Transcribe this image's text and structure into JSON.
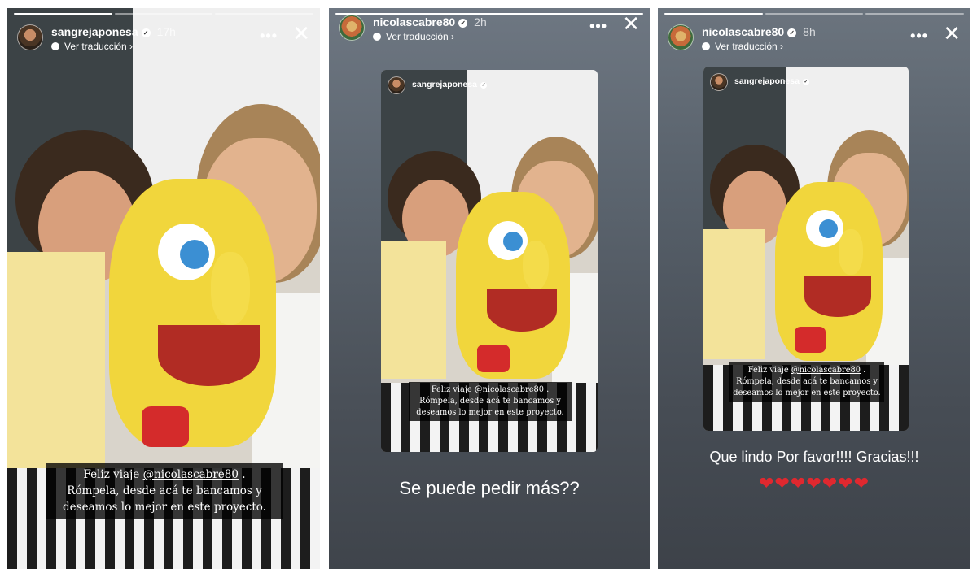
{
  "panels": [
    {
      "username": "sangrejaponesa",
      "time": "17h",
      "translate_label": "Ver traducción",
      "more": "•••",
      "close": "✕",
      "caption": {
        "prefix": "Feliz viaje ",
        "mention": "@nicolascabre80",
        "suffix": " .",
        "line2": "Rómpela, desde acá te bancamos y",
        "line3": "deseamos lo mejor en este proyecto."
      }
    },
    {
      "username": "nicolascabre80",
      "time": "2h",
      "translate_label": "Ver traducción",
      "more": "•••",
      "close": "✕",
      "embedded_username": "sangrejaponesa",
      "caption": {
        "prefix": "Feliz viaje ",
        "mention": "@nicolascabre80",
        "suffix": " .",
        "line2": "Rómpela, desde acá te bancamos y",
        "line3": "deseamos lo mejor en este proyecto."
      },
      "message": "Se puede pedir más??"
    },
    {
      "username": "nicolascabre80",
      "time": "8h",
      "translate_label": "Ver traducción",
      "more": "•••",
      "close": "✕",
      "embedded_username": "sangrejaponesa",
      "caption": {
        "prefix": "Feliz viaje ",
        "mention": "@nicolascabre80",
        "suffix": " .",
        "line2": "Rómpela, desde acá te bancamos y",
        "line3": "deseamos lo mejor en este proyecto."
      },
      "message": "Que lindo Por favor!!!! Gracias!!!",
      "hearts": "❤❤❤❤❤❤❤"
    }
  ],
  "colors": {
    "heart": "#e0282f",
    "caption_bg": "#000000"
  }
}
